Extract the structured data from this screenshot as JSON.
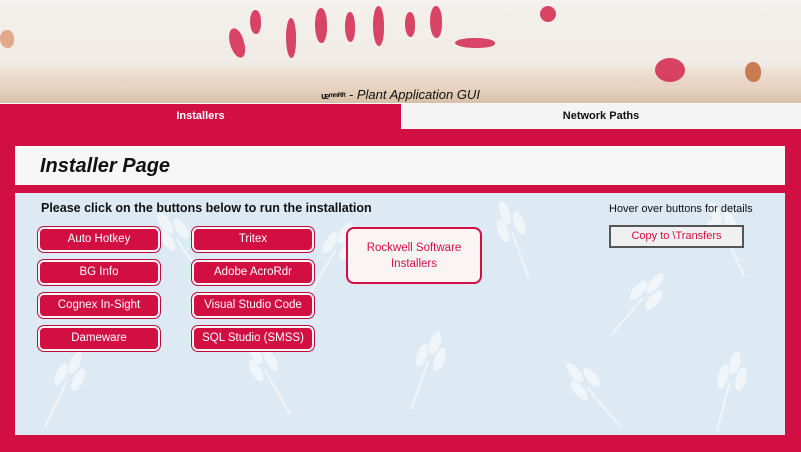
{
  "app": {
    "title_prefix": "ᵫᵐᵐᴿᴿ",
    "title": "- Plant Application GUI"
  },
  "tabs": [
    {
      "label": "Installers",
      "active": true
    },
    {
      "label": "Network Paths",
      "active": false
    }
  ],
  "page": {
    "title": "Installer Page",
    "instruction": "Please click on the buttons below to run the installation",
    "hover_note": "Hover over buttons for details"
  },
  "buttons": {
    "col1": [
      "Auto Hotkey",
      "BG Info",
      "Cognex In-Sight",
      "Dameware"
    ],
    "col2": [
      "Tritex",
      "Adobe AcroRdr",
      "Visual Studio Code",
      "SQL Studio (SMSS)"
    ],
    "rockwell": "Rockwell Software Installers",
    "copy": "Copy to \\Transfers"
  },
  "colors": {
    "accent": "#d10f43",
    "content_bg": "#dde9f3",
    "header_bg": "#f7f7f7"
  }
}
